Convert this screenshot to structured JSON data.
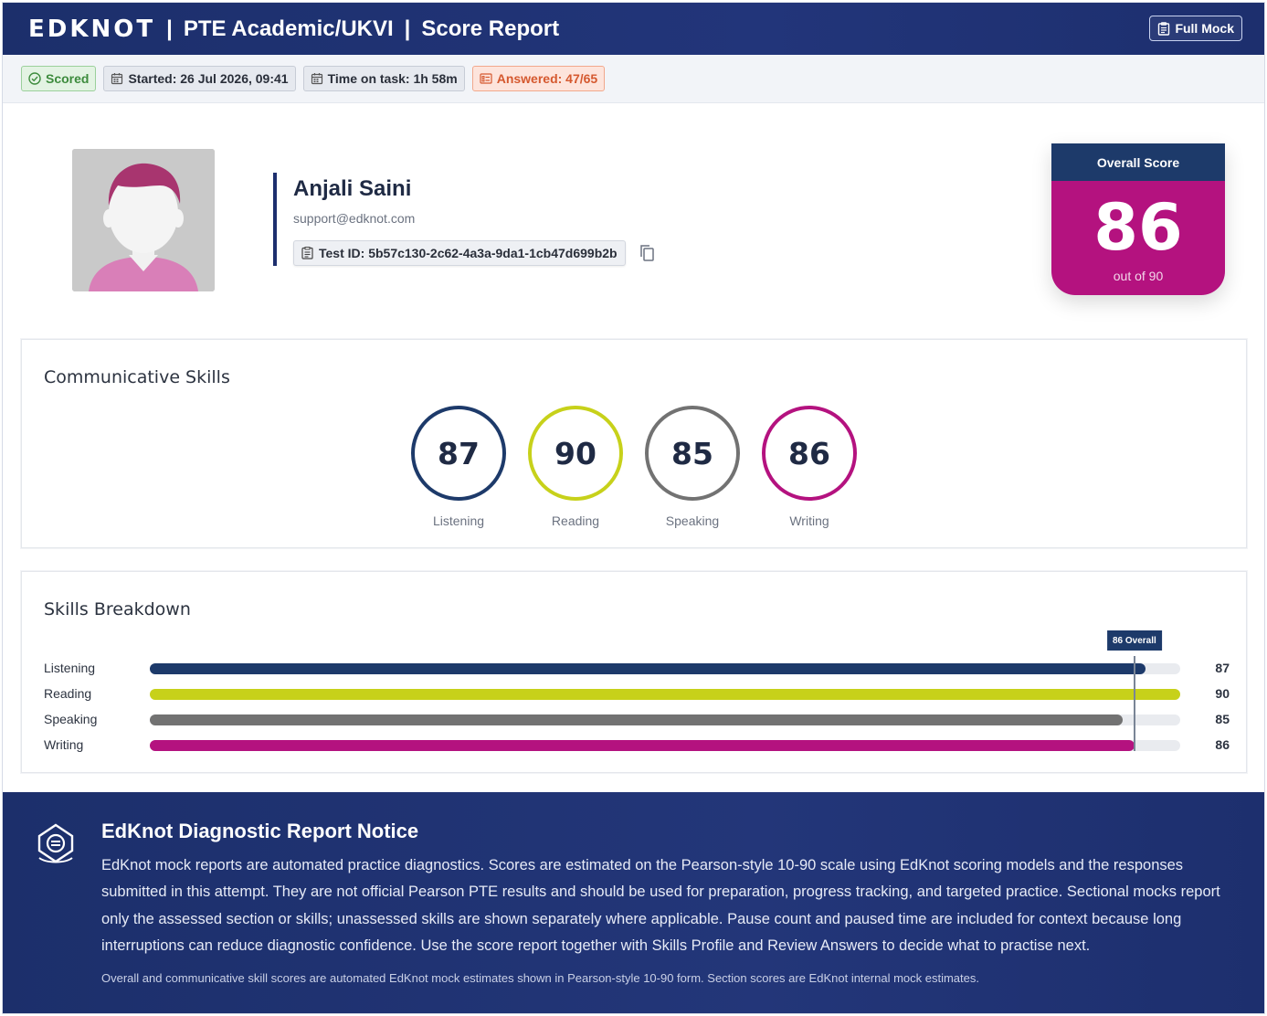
{
  "header": {
    "logo_text": "EDKNOT",
    "separator": "|",
    "exam": "PTE Academic/UKVI",
    "report": "Score Report",
    "full_mock_label": "Full Mock"
  },
  "status": {
    "scored": "Scored",
    "started": "Started: 26 Jul 2026, 09:41",
    "time_on_task": "Time on task: 1h 58m",
    "answered": "Answered: 47/65"
  },
  "profile": {
    "name": "Anjali Saini",
    "email": "support@edknot.com",
    "test_id": "Test ID: 5b57c130-2c62-4a3a-9da1-1cb47d699b2b"
  },
  "overall": {
    "title": "Overall Score",
    "score": "86",
    "out_of": "out of 90"
  },
  "communicative": {
    "title": "Communicative Skills",
    "skills": [
      {
        "label": "Listening",
        "score": "87",
        "color": "#1d3a6a"
      },
      {
        "label": "Reading",
        "score": "90",
        "color": "#c7d11a"
      },
      {
        "label": "Speaking",
        "score": "85",
        "color": "#727272"
      },
      {
        "label": "Writing",
        "score": "86",
        "color": "#b4127f"
      }
    ]
  },
  "breakdown": {
    "title": "Skills Breakdown",
    "overall_marker": "86 Overall",
    "overall_value": 86,
    "scale_max": 90,
    "rows": [
      {
        "label": "Listening",
        "value": 87,
        "display": "87",
        "color": "#1d3a6a"
      },
      {
        "label": "Reading",
        "value": 90,
        "display": "90",
        "color": "#c7d11a"
      },
      {
        "label": "Speaking",
        "value": 85,
        "display": "85",
        "color": "#727272"
      },
      {
        "label": "Writing",
        "value": 86,
        "display": "86",
        "color": "#b4127f"
      }
    ]
  },
  "notice": {
    "title": "EdKnot Diagnostic Report Notice",
    "body": "EdKnot mock reports are automated practice diagnostics. Scores are estimated on the Pearson-style 10-90 scale using EdKnot scoring models and the responses submitted in this attempt. They are not official Pearson PTE results and should be used for preparation, progress tracking, and targeted practice. Sectional mocks report only the assessed section or skills; unassessed skills are shown separately where applicable. Pause count and paused time are included for context because long interruptions can reduce diagnostic confidence. Use the score report together with Skills Profile and Review Answers to decide what to practise next.",
    "footnote": "Overall and communicative skill scores are automated EdKnot mock estimates shown in Pearson-style 10-90 form. Section scores are EdKnot internal mock estimates."
  }
}
